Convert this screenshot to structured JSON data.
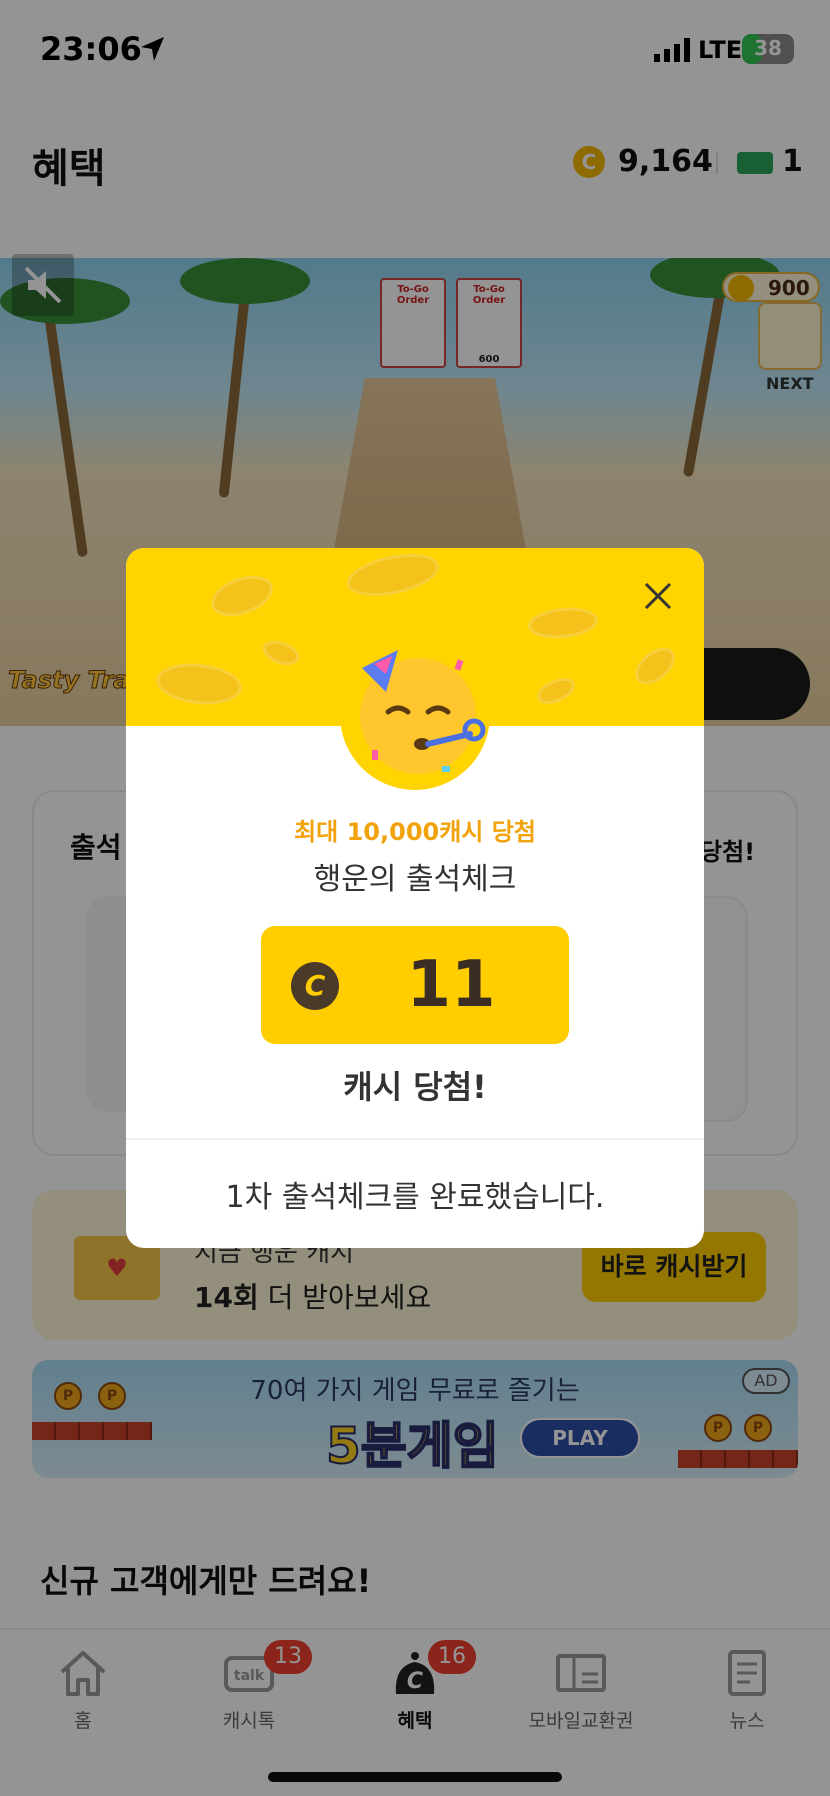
{
  "status_bar": {
    "time": "23:06",
    "network": "LTE",
    "battery": "38",
    "battery_level": 0.38
  },
  "header": {
    "title": "혜택",
    "coin_balance": "9,164",
    "ticket_count": "1"
  },
  "game_banner": {
    "score": "900",
    "next_label": "NEXT",
    "logo_text": "Tasty Travels",
    "order_card_text": "To-Go Order",
    "order_card_value": "600"
  },
  "attendance_card": {
    "title": "출석",
    "right_text": "당첨!"
  },
  "promo": {
    "line1": "지금 행운 캐시",
    "line2_count": "14회",
    "line2_rest": " 더 받아보세요",
    "button_label": "바로 캐시받기"
  },
  "ad_banner": {
    "subtitle": "70여 가지 게임 무료로 즐기는",
    "title": "5분게임",
    "play_label": "PLAY",
    "ad_tag": "AD",
    "coin_letter": "P"
  },
  "section_title": "신규 고객에게만 드려요!",
  "tab_bar": {
    "tabs": [
      {
        "label": "홈",
        "icon": "home-icon",
        "active": false
      },
      {
        "label": "캐시톡",
        "icon": "talk-icon",
        "active": false,
        "badge": "13"
      },
      {
        "label": "혜택",
        "icon": "benefit-icon",
        "active": true,
        "badge": "16"
      },
      {
        "label": "모바일교환권",
        "icon": "voucher-icon",
        "active": false
      },
      {
        "label": "뉴스",
        "icon": "news-icon",
        "active": false
      }
    ]
  },
  "modal": {
    "subtitle": "최대 10,000캐시 당첨",
    "title": "행운의 출석체크",
    "coin_symbol": "C",
    "amount": "11",
    "win_text": "캐시 당첨!",
    "message": "1차 출석체크를 완료했습니다."
  },
  "colors": {
    "accent_yellow": "#ffd400",
    "badge_red": "#f0412f",
    "subtitle_orange": "#f2a20a"
  }
}
